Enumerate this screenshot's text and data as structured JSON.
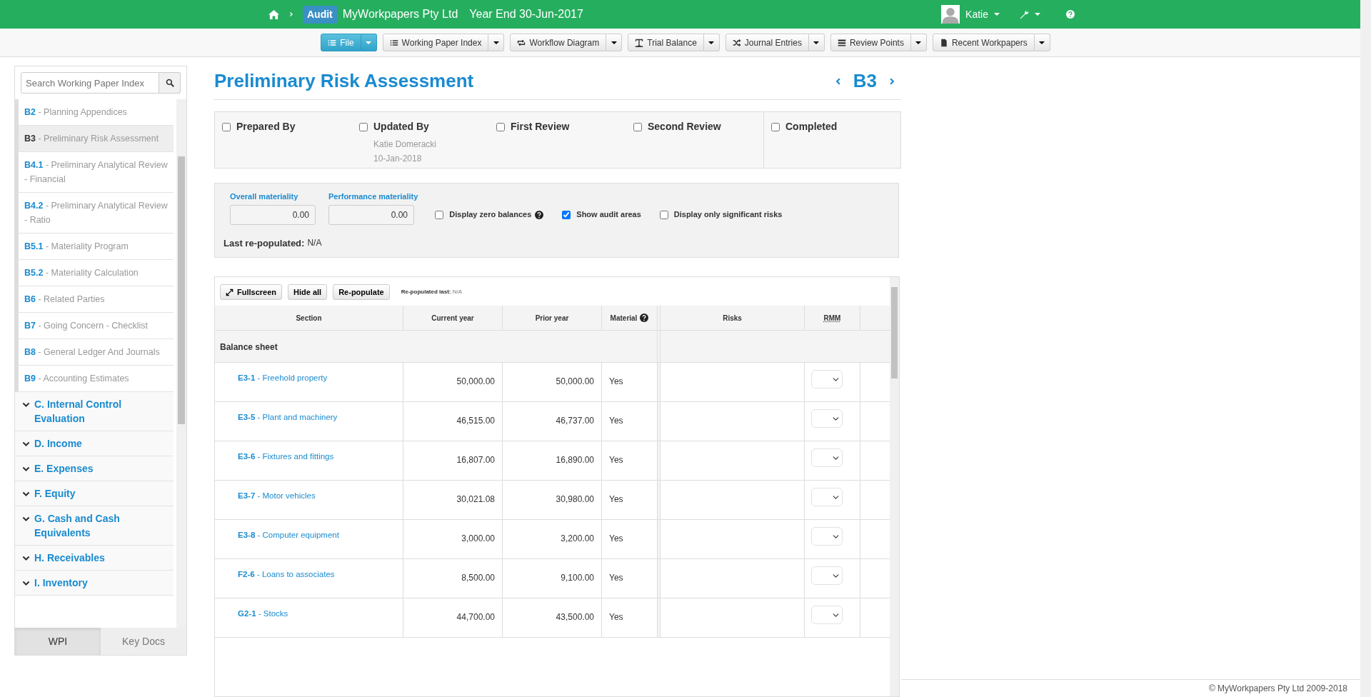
{
  "topbar": {
    "badge": "Audit",
    "client": "MyWorkpapers Pty Ltd",
    "year_end": "Year End 30-Jun-2017",
    "user": "Katie"
  },
  "toolbar": [
    {
      "label": "File",
      "kind": "list",
      "primary": true
    },
    {
      "label": "Working Paper Index",
      "kind": "list",
      "primary": false
    },
    {
      "label": "Workflow Diagram",
      "kind": "loop",
      "primary": false
    },
    {
      "label": "Trial Balance",
      "kind": "text",
      "primary": false
    },
    {
      "label": "Journal Entries",
      "kind": "shuffle",
      "primary": false
    },
    {
      "label": "Review Points",
      "kind": "stack",
      "primary": false
    },
    {
      "label": "Recent Workpapers",
      "kind": "file",
      "primary": false
    }
  ],
  "sidebar": {
    "search_placeholder": "Search Working Paper Index",
    "papers": [
      {
        "label": "**B2** - Planning Appendices",
        "selected": false
      },
      {
        "label": "**B3** - Preliminary Risk Assessment",
        "selected": true
      },
      {
        "label": "**B4.1** - Preliminary Analytical Review - Financial",
        "selected": false
      },
      {
        "label": "**B4.2** - Preliminary Analytical Review - Ratio",
        "selected": false
      },
      {
        "label": "**B5.1** - Materiality Program",
        "selected": false
      },
      {
        "label": "**B5.2** - Materiality Calculation",
        "selected": false
      },
      {
        "label": "**B6** - Related Parties",
        "selected": false
      },
      {
        "label": "**B7** - Going Concern - Checklist",
        "selected": false
      },
      {
        "label": "**B8** - General Ledger And Journals",
        "selected": false
      },
      {
        "label": "**B9** - Accounting Estimates",
        "selected": false
      }
    ],
    "sections": [
      {
        "label": "C. Internal Control Evaluation"
      },
      {
        "label": "D. Income"
      },
      {
        "label": "E. Expenses"
      },
      {
        "label": "F. Equity"
      },
      {
        "label": "G. Cash and Cash Equivalents"
      },
      {
        "label": "H. Receivables"
      },
      {
        "label": "I. Inventory"
      }
    ],
    "tabs": [
      {
        "label": "WPI",
        "selected": true
      },
      {
        "label": "Key Docs",
        "selected": false
      }
    ]
  },
  "page": {
    "title": "Preliminary Risk Assessment",
    "code": "B3"
  },
  "signoffs": [
    {
      "label": "Prepared By",
      "checked": false
    },
    {
      "label": "Updated By",
      "checked": false,
      "name": "Katie Domeracki",
      "date": "10-Jan-2018"
    },
    {
      "label": "First Review",
      "checked": false
    },
    {
      "label": "Second Review",
      "checked": false
    },
    {
      "label": "Completed",
      "checked": false
    }
  ],
  "filters": {
    "fields": [
      {
        "label": "Overall materiality",
        "value": "0.00"
      },
      {
        "label": "Performance materiality",
        "value": "0.00"
      }
    ],
    "options": [
      {
        "label": "Display zero balances",
        "checked": false,
        "help": true
      },
      {
        "label": "Show audit areas",
        "checked": true,
        "help": false
      },
      {
        "label": "Display only significant risks",
        "checked": false,
        "help": false
      }
    ],
    "last_label": "Last re-populated:",
    "last_value": "N/A"
  },
  "table": {
    "buttons": [
      {
        "label": "Fullscreen",
        "kind": "expand"
      },
      {
        "label": "Hide all",
        "kind": "plain"
      },
      {
        "label": "Re-populate",
        "kind": "plain"
      }
    ],
    "note_label": "Re-populated last:",
    "note_value": "N/A",
    "columns": [
      {
        "label": "Section",
        "help": false
      },
      {
        "label": "Current year",
        "help": false
      },
      {
        "label": "Prior year",
        "help": false
      },
      {
        "label": "Material",
        "help": true
      },
      {
        "label": "Risks",
        "help": false
      },
      {
        "label": "RMM",
        "help": false
      }
    ],
    "group": "Balance sheet",
    "rows": [
      {
        "section": "**E3-1** - Freehold property",
        "current": "50,000.00",
        "prior": "50,000.00",
        "material": "Yes"
      },
      {
        "section": "**E3-5** - Plant and machinery",
        "current": "46,515.00",
        "prior": "46,737.00",
        "material": "Yes"
      },
      {
        "section": "**E3-6** - Fixtures and fittings",
        "current": "16,807.00",
        "prior": "16,890.00",
        "material": "Yes"
      },
      {
        "section": "**E3-7** - Motor vehicles",
        "current": "30,021.08",
        "prior": "30,980.00",
        "material": "Yes"
      },
      {
        "section": "**E3-8** - Computer equipment",
        "current": "3,000.00",
        "prior": "3,200.00",
        "material": "Yes"
      },
      {
        "section": "**F2-6** - Loans to associates",
        "current": "8,500.00",
        "prior": "9,100.00",
        "material": "Yes"
      },
      {
        "section": "**G2-1** - Stocks",
        "current": "44,700.00",
        "prior": "43,500.00",
        "material": "Yes"
      }
    ]
  },
  "footer": "© MyWorkpapers Pty Ltd 2009-2018"
}
